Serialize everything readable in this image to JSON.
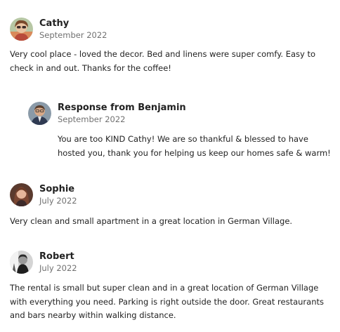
{
  "reviews": [
    {
      "name": "Cathy",
      "date": "September 2022",
      "text": "Very cool place - loved the decor. Bed and linens were super comfy. Easy to check in and out. Thanks for the coffee!",
      "response": {
        "name": "Response from Benjamin",
        "date": "September 2022",
        "text": "You are too KIND Cathy! We are so thankful & blessed to have hosted you, thank you for helping us keep our homes safe & warm!"
      }
    },
    {
      "name": "Sophie",
      "date": "July 2022",
      "text": "Very clean and small apartment in a great location in German Village."
    },
    {
      "name": "Robert",
      "date": "July 2022",
      "text": "The rental is small but super clean and in a great location of German Village with everything you need. Parking is right outside the door. Great restaurants and bars nearby within walking distance."
    }
  ]
}
